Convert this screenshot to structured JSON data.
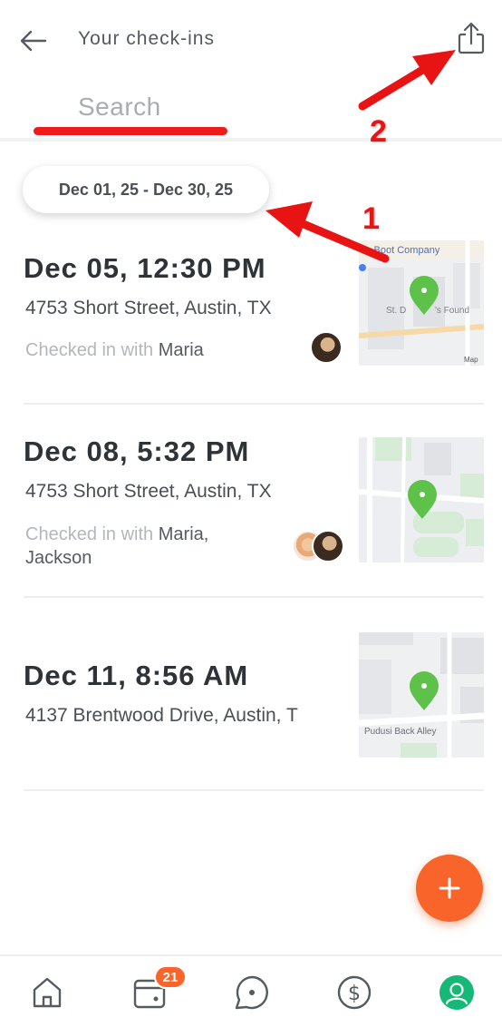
{
  "header": {
    "title": "Your check-ins",
    "back_icon": "arrow-left-icon",
    "share_icon": "share-icon"
  },
  "search": {
    "placeholder": "Search",
    "value": ""
  },
  "date_range": "Dec 01, 25 - Dec 30, 25",
  "checkins": [
    {
      "date": "Dec 05, 12:30 PM",
      "address": "4753 Short Street, Austin, TX",
      "with_label": "Checked in with",
      "with_names": "Maria",
      "map_labels": [
        "s Boot Company",
        "St. D",
        "'s Found",
        "Map"
      ]
    },
    {
      "date": "Dec 08, 5:32 PM",
      "address": "4753 Short Street, Austin, TX",
      "with_label": "Checked in with",
      "with_names": "Maria, Jackson",
      "map_labels": []
    },
    {
      "date": "Dec 11, 8:56 AM",
      "address": "4137 Brentwood Drive, Austin, T",
      "with_label": "",
      "with_names": "",
      "map_labels": [
        "Pudusi Back Alley"
      ]
    }
  ],
  "fab": {
    "icon": "plus-icon",
    "label": "+"
  },
  "bottom_nav": {
    "items": [
      {
        "icon": "home-icon"
      },
      {
        "icon": "calendar-icon",
        "badge": "21"
      },
      {
        "icon": "chat-icon"
      },
      {
        "icon": "dollar-icon"
      },
      {
        "icon": "profile-icon"
      }
    ]
  },
  "annotations": {
    "label_1": "1",
    "label_2": "2"
  },
  "colors": {
    "accent": "#f9642a",
    "annotation_red": "#e81414",
    "map_pin": "#5ec24a",
    "profile_active": "#16b876"
  }
}
